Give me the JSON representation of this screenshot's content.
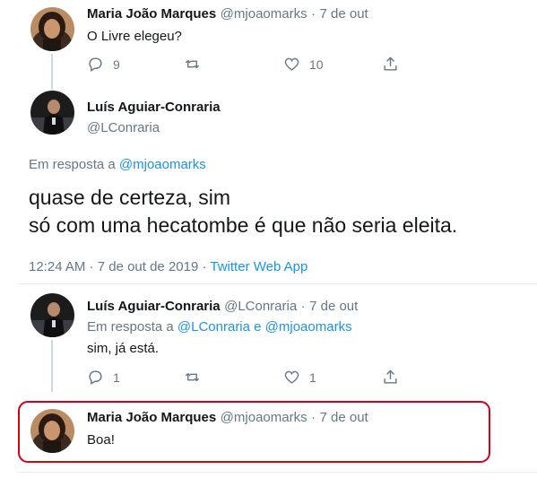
{
  "tweet1": {
    "name": "Maria João Marques",
    "handle": "@mjoaomarks",
    "sep": "·",
    "date": "7 de out",
    "text": "O Livre elegeu?",
    "replies": "9",
    "likes": "10"
  },
  "main": {
    "name": "Luís Aguiar-Conraria",
    "handle": "@LConraria",
    "reply_prefix": "Em resposta a",
    "reply_to": "@mjoaomarks",
    "text_line1": "quase de certeza, sim",
    "text_line2": "só com uma hecatombe é que não seria eleita.",
    "timestamp": "12:24 AM · 7 de out de 2019 ·",
    "source": "Twitter Web App"
  },
  "tweet3": {
    "name": "Luís Aguiar-Conraria",
    "handle": "@LConraria",
    "sep": "·",
    "date": "7 de out",
    "reply_prefix": "Em resposta a",
    "reply_to": "@LConraria e @mjoaomarks",
    "text": "sim, já está.",
    "replies": "1",
    "likes": "1"
  },
  "tweet4": {
    "name": "Maria João Marques",
    "handle": "@mjoaomarks",
    "sep": "·",
    "date": "7 de out",
    "text": "Boa!"
  },
  "colors": {
    "link": "#1b95e0",
    "grey": "#657786",
    "highlight_border": "#d0021b"
  },
  "icons": [
    "reply-icon",
    "retweet-icon",
    "like-icon",
    "share-icon"
  ]
}
